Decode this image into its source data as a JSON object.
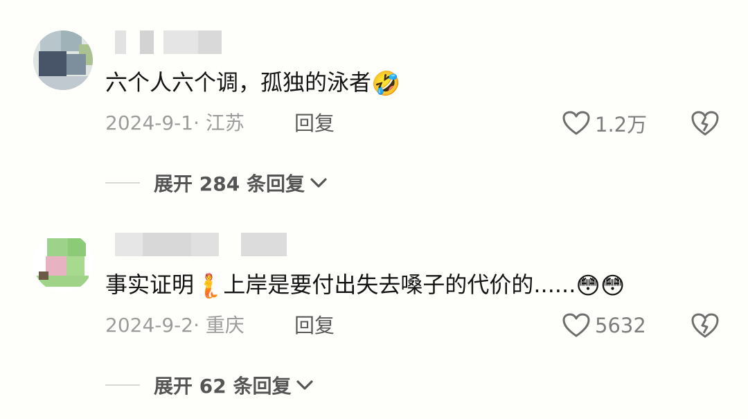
{
  "comments": [
    {
      "text": "六个人六个调，孤独的泳者",
      "emojis": [
        "🤣"
      ],
      "emoji_names": [
        "laughing-crying-face"
      ],
      "date": "2024-9-1",
      "location": "江苏",
      "reply_label": "回复",
      "likes": "1.2万",
      "expand_label": "展开 284 条回复"
    },
    {
      "text_before": "事实证明",
      "inline_emoji": "🧜",
      "inline_emoji_name": "merperson",
      "text_after": "上岸是要付出失去嗓子的代价的......",
      "emojis": [
        "😳",
        "😳"
      ],
      "emoji_names": [
        "dizzy-eyes-face",
        "dizzy-eyes-face"
      ],
      "date": "2024-9-2",
      "location": "重庆",
      "reply_label": "回复",
      "likes": "5632",
      "expand_label": "展开 62 条回复"
    }
  ],
  "colors": {
    "background": "#fefefb",
    "text": "#141414",
    "meta": "#9c9c9c",
    "icon": "#6e6e6e"
  },
  "icons": [
    "heart-outline-icon",
    "broken-heart-icon",
    "chevron-down-icon"
  ]
}
